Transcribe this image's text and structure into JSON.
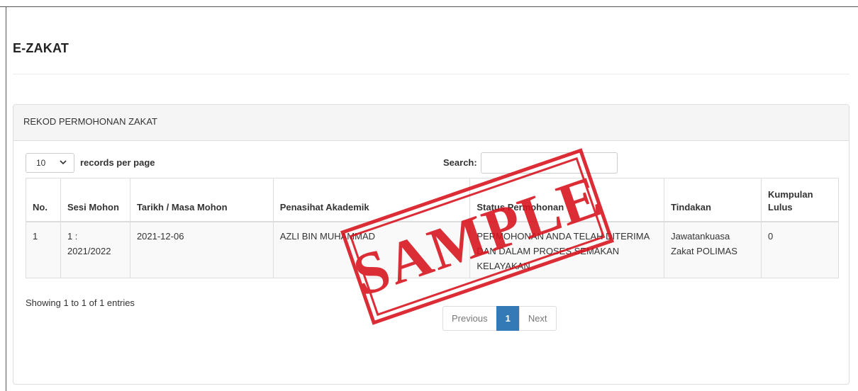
{
  "page": {
    "title": "E-ZAKAT"
  },
  "panel": {
    "heading": "REKOD PERMOHONAN ZAKAT"
  },
  "controls": {
    "length_value": "10",
    "length_label": "records per page",
    "search_label": "Search:",
    "search_value": ""
  },
  "table": {
    "headers": {
      "no": "No.",
      "sesi": "Sesi Mohon",
      "tarikh": "Tarikh / Masa Mohon",
      "penasihat": "Penasihat Akademik",
      "status": "Status Permohonan",
      "tindakan": "Tindakan",
      "kumpulan": "Kumpulan Lulus"
    },
    "rows": [
      {
        "no": "1",
        "sesi": "1 : 2021/2022",
        "tarikh": "2021-12-06",
        "penasihat": "AZLI BIN MUHAMMAD",
        "status": "PERMOHONAN ANDA TELAH DITERIMA DAN DALAM PROSES SEMAKAN KELAYAKAN",
        "tindakan": "Jawatankuasa Zakat POLIMAS",
        "kumpulan": "0"
      }
    ]
  },
  "footer": {
    "info": "Showing 1 to 1 of 1 entries",
    "pagination": {
      "previous": "Previous",
      "current": "1",
      "next": "Next"
    }
  },
  "watermark": {
    "text": "SAMPLE",
    "color": "#d8111c"
  },
  "colors": {
    "accent": "#337ab7",
    "stamp": "#d8111c"
  },
  "icons": {
    "length_select": "chevron-down-icon"
  }
}
